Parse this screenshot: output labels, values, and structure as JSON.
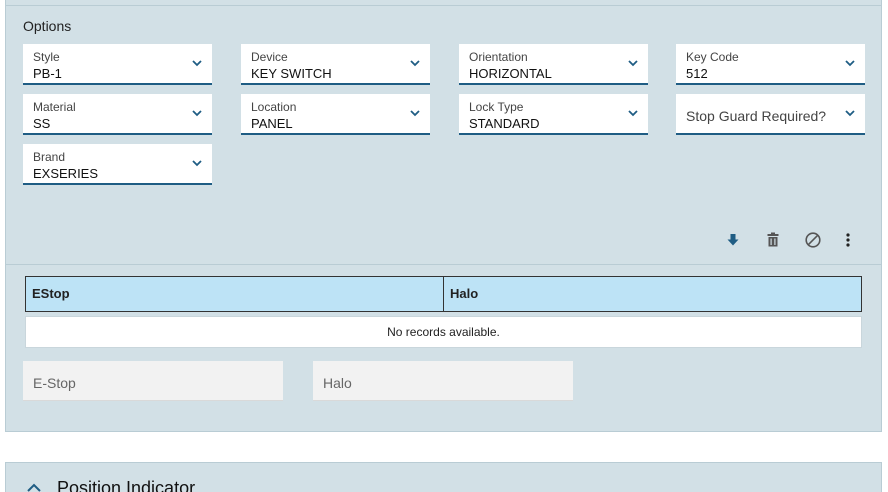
{
  "options": {
    "title": "Options",
    "fields": [
      {
        "label": "Style",
        "value": "PB-1"
      },
      {
        "label": "Device",
        "value": "KEY SWITCH"
      },
      {
        "label": "Orientation",
        "value": "HORIZONTAL"
      },
      {
        "label": "Key Code",
        "value": "512"
      },
      {
        "label": "Material",
        "value": "SS"
      },
      {
        "label": "Location",
        "value": "PANEL"
      },
      {
        "label": "Lock Type",
        "value": "STANDARD"
      },
      {
        "placeholder": "Stop Guard Required?"
      },
      {
        "label": "Brand",
        "value": "EXSERIES"
      }
    ]
  },
  "toolbar": {
    "icons": [
      "download-icon",
      "trash-icon",
      "ban-icon",
      "more-vertical-icon"
    ],
    "accent": "#1f5d84"
  },
  "grid": {
    "columns": [
      "EStop",
      "Halo"
    ],
    "empty_text": "No records available.",
    "header_color": "#bde3f6"
  },
  "readonly": {
    "estop_placeholder": "E-Stop",
    "halo_placeholder": "Halo"
  },
  "position_indicator": {
    "title": "Position Indicator"
  }
}
